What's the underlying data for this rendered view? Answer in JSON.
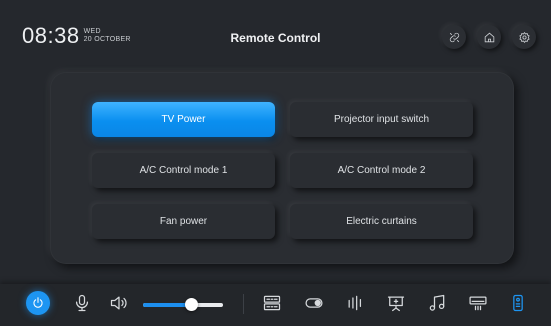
{
  "header": {
    "time": "08:38",
    "weekday": "WED",
    "date": "20 OCTOBER",
    "title": "Remote Control",
    "buttons": [
      {
        "name": "link-button",
        "icon": "link-icon"
      },
      {
        "name": "home-button",
        "icon": "home-icon"
      },
      {
        "name": "settings-button",
        "icon": "gear-icon"
      }
    ]
  },
  "controls": [
    {
      "label": "TV Power",
      "active": true
    },
    {
      "label": "Projector input switch",
      "active": false
    },
    {
      "label": "A/C Control mode 1",
      "active": false
    },
    {
      "label": "A/C Control mode 2",
      "active": false
    },
    {
      "label": "Fan power",
      "active": false
    },
    {
      "label": "Electric curtains",
      "active": false
    }
  ],
  "bottombar": {
    "volume_percent": 60,
    "icons": [
      "power-icon",
      "microphone-icon",
      "speaker-icon",
      "matrix-switch-icon",
      "toggle-icon",
      "equalizer-icon",
      "presentation-icon",
      "music-note-icon",
      "air-conditioner-icon",
      "remote-icon"
    ]
  },
  "colors": {
    "accent": "#1d95f2",
    "background": "#25282d",
    "panel": "#2a2d32"
  }
}
